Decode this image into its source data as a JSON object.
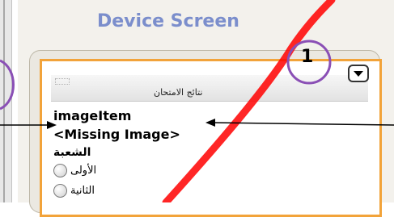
{
  "device_screen": {
    "title": "Device Screen"
  },
  "form": {
    "header_title": "نتائج الامتحان",
    "item_title": "imageItem",
    "missing_image_text": "<Missing Image>",
    "group_label": "الشعبة",
    "options": [
      "الأولى",
      "الثانية"
    ]
  },
  "annotation": {
    "number_badge": "1"
  },
  "colors": {
    "title": "#7b8ecc",
    "form_border": "#f2a33a",
    "circle_annotation": "#8a4fb5",
    "watermark": "#ff0000"
  },
  "icons": {
    "dropdown": "chevron-down-icon",
    "radio": "radio-button-icon"
  }
}
